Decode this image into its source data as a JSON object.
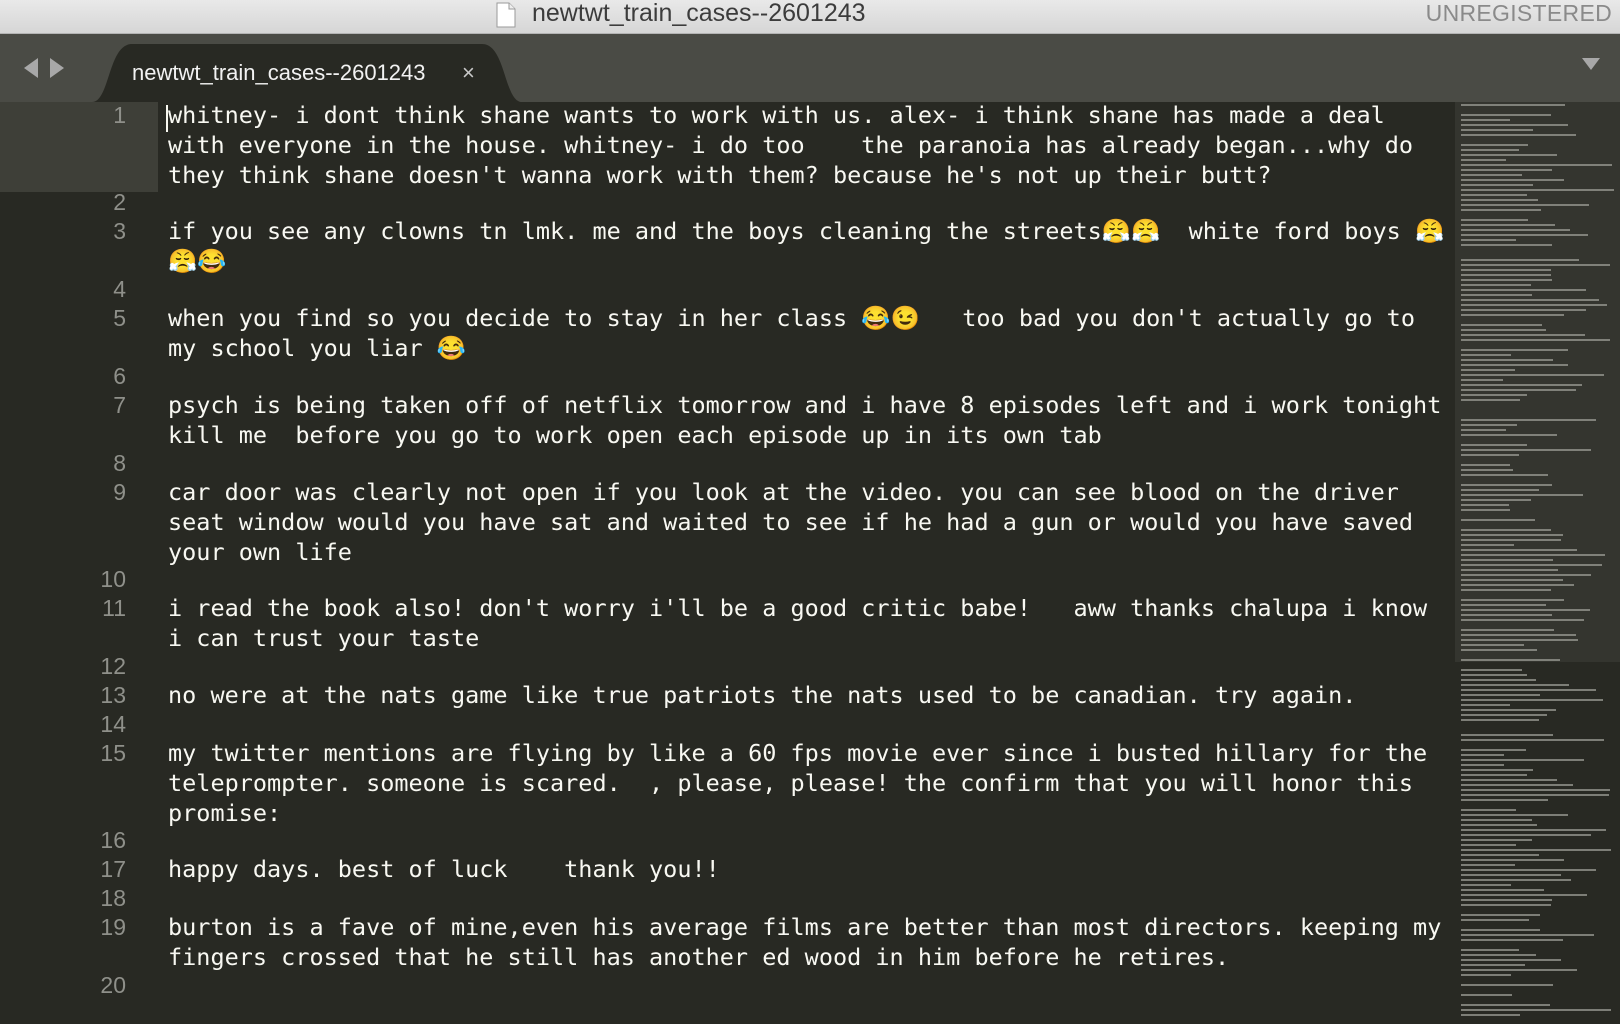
{
  "window": {
    "title": "newtwt_train_cases--2601243",
    "registration": "UNREGISTERED"
  },
  "tabs": [
    {
      "label": "newtwt_train_cases--2601243",
      "close": "×"
    }
  ],
  "icons": {
    "nav_back": "triangle-left-icon",
    "nav_forward": "triangle-right-icon",
    "tab_menu": "chevron-down-icon",
    "document": "document-icon"
  },
  "colors": {
    "editor_bg": "#282923",
    "text": "#f8f8f2",
    "line_number": "#8f908a",
    "tab_strip": "#4a4b45"
  },
  "editor": {
    "lines": [
      {
        "n": "1",
        "text": "whitney- i dont think shane wants to work with us. alex- i think shane has made a deal with everyone in the house. whitney- i do too    the paranoia has already began...why do they think shane doesn't wanna work with them? because he's not up their butt?"
      },
      {
        "n": "2",
        "text": ""
      },
      {
        "n": "3",
        "text": "if you see any clowns tn lmk. me and the boys cleaning the streets😤😤  white ford boys 😤😤😂"
      },
      {
        "n": "4",
        "text": ""
      },
      {
        "n": "5",
        "text": "when you find so you decide to stay in her class 😂😉   too bad you don't actually go to my school you liar 😂"
      },
      {
        "n": "6",
        "text": ""
      },
      {
        "n": "7",
        "text": "psych is being taken off of netflix tomorrow and i have 8 episodes left and i work tonight kill me  before you go to work open each episode up in its own tab"
      },
      {
        "n": "8",
        "text": ""
      },
      {
        "n": "9",
        "text": "car door was clearly not open if you look at the video. you can see blood on the driver seat window would you have sat and waited to see if he had a gun or would you have saved your own life"
      },
      {
        "n": "10",
        "text": ""
      },
      {
        "n": "11",
        "text": "i read the book also! don't worry i'll be a good critic babe!   aww thanks chalupa i know i can trust your taste"
      },
      {
        "n": "12",
        "text": ""
      },
      {
        "n": "13",
        "text": "no were at the nats game like true patriots the nats used to be canadian. try again."
      },
      {
        "n": "14",
        "text": ""
      },
      {
        "n": "15",
        "text": "my twitter mentions are flying by like a 60 fps movie ever since i busted hillary for the teleprompter. someone is scared.  , please, please! the confirm that you will honor this promise:"
      },
      {
        "n": "16",
        "text": ""
      },
      {
        "n": "17",
        "text": "happy days. best of luck    thank you!!"
      },
      {
        "n": "18",
        "text": ""
      },
      {
        "n": "19",
        "text": "burton is a fave of mine,even his average films are better than most directors. keeping my fingers crossed that he still has another ed wood in him before he retires."
      },
      {
        "n": "20",
        "text": ""
      }
    ]
  }
}
